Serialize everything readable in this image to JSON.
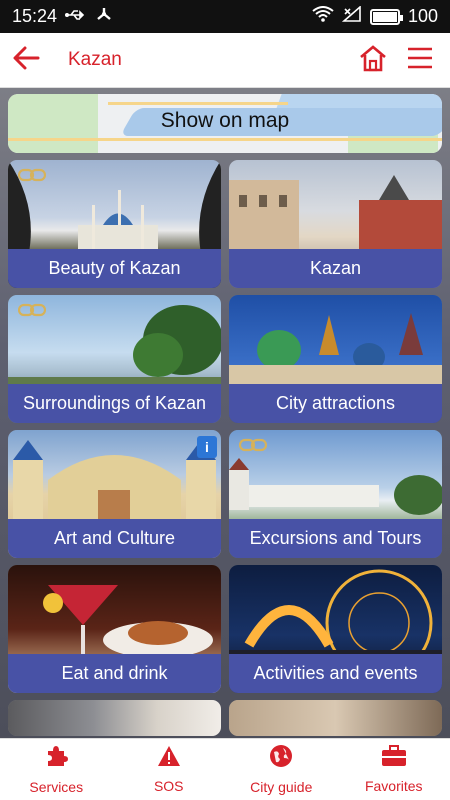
{
  "status": {
    "time": "15:24",
    "battery": "100",
    "battery_level": 1.0
  },
  "header": {
    "title": "Kazan"
  },
  "map": {
    "label": "Show on map"
  },
  "tiles": [
    {
      "label": "Beauty of Kazan",
      "link": true,
      "info": false
    },
    {
      "label": "Kazan",
      "link": false,
      "info": false
    },
    {
      "label": "Surroundings of Kazan",
      "link": true,
      "info": false
    },
    {
      "label": "City attractions",
      "link": false,
      "info": false
    },
    {
      "label": "Art and Culture",
      "link": false,
      "info": true,
      "info_text": "i"
    },
    {
      "label": "Excursions and Tours",
      "link": true,
      "info": false
    },
    {
      "label": "Eat and drink",
      "link": false,
      "info": false
    },
    {
      "label": "Activities and events",
      "link": false,
      "info": false
    }
  ],
  "bottom_nav": [
    {
      "label": "Services",
      "icon": "puzzle-icon"
    },
    {
      "label": "SOS",
      "icon": "warning-icon"
    },
    {
      "label": "City guide",
      "icon": "globe-icon"
    },
    {
      "label": "Favorites",
      "icon": "suitcase-icon"
    }
  ],
  "colors": {
    "accent": "#d7222b",
    "caption_bg": "#4852a6",
    "info_badge": "#2c76d6"
  }
}
